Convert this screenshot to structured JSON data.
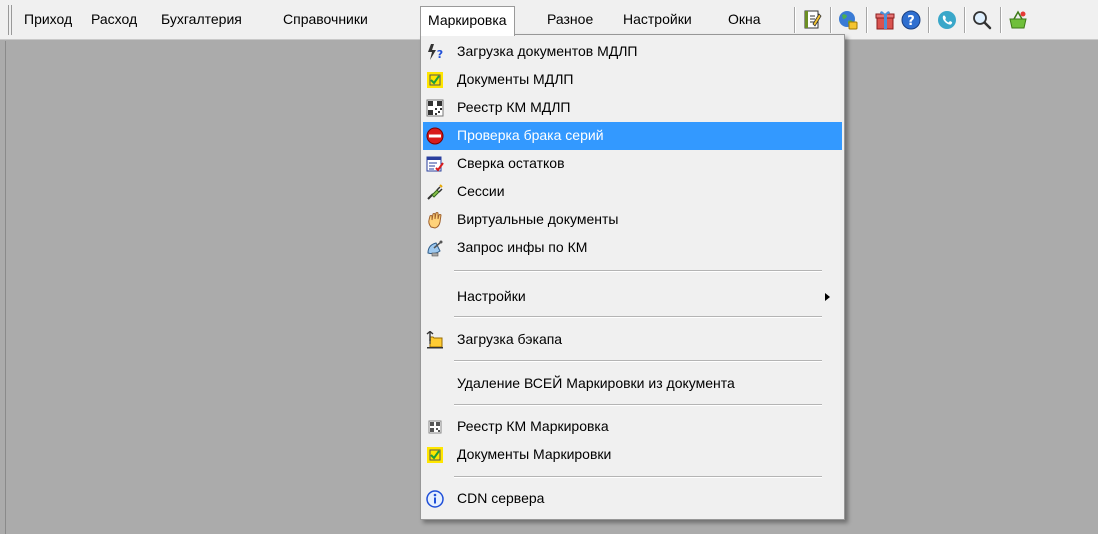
{
  "menubar": {
    "items": [
      "Приход",
      "Расход",
      "Бухгалтерия",
      "Справочники",
      "Маркировка",
      "Разное",
      "Настройки",
      "Окна"
    ],
    "open_item": "Маркировка"
  },
  "toolbar": {
    "icons": [
      "notebook-icon",
      "globe-icon",
      "gift-box-icon",
      "help-icon",
      "phone-icon",
      "magnifier-icon",
      "basket-icon"
    ]
  },
  "dropdown": {
    "items": [
      {
        "label": "Загрузка документов МДЛП",
        "icon": "lightning-question-icon"
      },
      {
        "label": "Документы МДЛП",
        "icon": "checkbox-yellow-icon"
      },
      {
        "label": "Реестр КМ МДЛП",
        "icon": "qr-code-icon"
      },
      {
        "label": "Проверка брака серий",
        "icon": "no-entry-icon",
        "highlighted": true
      },
      {
        "label": "Сверка остатков",
        "icon": "form-check-icon"
      },
      {
        "label": "Сессии",
        "icon": "connector-plug-icon"
      },
      {
        "label": "Виртуальные документы",
        "icon": "hand-icon"
      },
      {
        "label": "Запрос инфы по КМ",
        "icon": "satellite-dish-icon"
      },
      {
        "label": "Настройки",
        "submenu": true
      },
      {
        "label": "Загрузка бэкапа",
        "icon": "folder-upload-icon"
      },
      {
        "label": "Удаление ВСЕЙ Маркировки из документа"
      },
      {
        "label": "Реестр КМ Маркировка",
        "icon": "qr-code-small-icon"
      },
      {
        "label": "Документы Маркировки",
        "icon": "checkbox-yellow-icon"
      },
      {
        "label": "CDN сервера",
        "icon": "info-icon"
      }
    ]
  },
  "colors": {
    "highlight": "#3399ff",
    "menubar_bg": "#f0f0f0",
    "workspace_bg": "#ababab"
  }
}
